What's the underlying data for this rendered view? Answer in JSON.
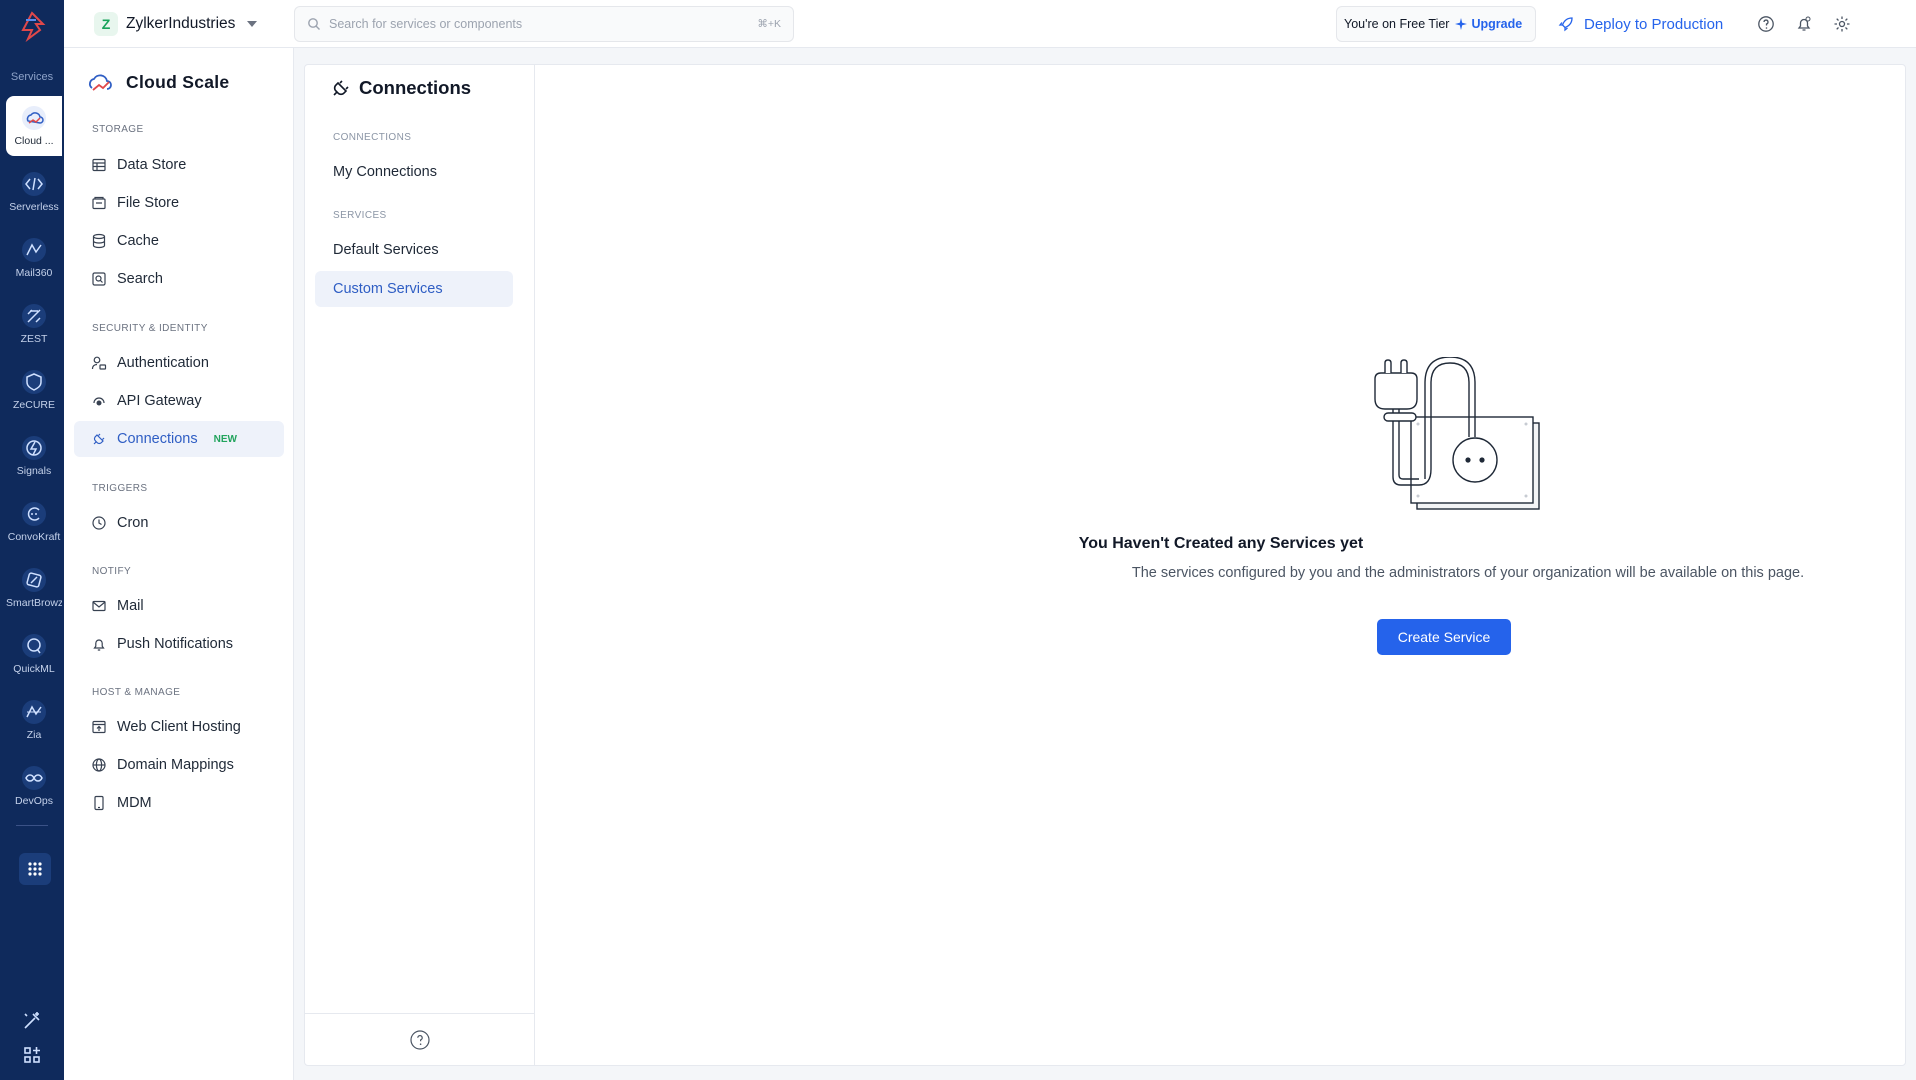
{
  "rail": {
    "services_label": "Services",
    "items": [
      {
        "label": "Cloud ...",
        "icon": "cloud-icon"
      },
      {
        "label": "Serverless",
        "icon": "serverless-icon"
      },
      {
        "label": "Mail360",
        "icon": "mail360-icon"
      },
      {
        "label": "ZEST",
        "icon": "zest-icon"
      },
      {
        "label": "ZeCURE",
        "icon": "zecure-icon"
      },
      {
        "label": "Signals",
        "icon": "signals-icon"
      },
      {
        "label": "ConvoKraft",
        "icon": "convokraft-icon"
      },
      {
        "label": "SmartBrowz",
        "icon": "smartbrowz-icon"
      },
      {
        "label": "QuickML",
        "icon": "quickml-icon"
      },
      {
        "label": "Zia",
        "icon": "zia-icon"
      },
      {
        "label": "DevOps",
        "icon": "devops-icon"
      }
    ]
  },
  "topbar": {
    "org_initial": "Z",
    "org_name": "ZylkerIndustries",
    "search_placeholder": "Search for services or components",
    "search_shortcut": "⌘+K",
    "tier_text": "You're on Free Tier",
    "upgrade_label": "Upgrade",
    "deploy_label": "Deploy to Production"
  },
  "sidebar": {
    "brand": "Cloud Scale",
    "sections": {
      "storage": "STORAGE",
      "security": "SECURITY & IDENTITY",
      "triggers": "TRIGGERS",
      "notify": "NOTIFY",
      "host": "HOST & MANAGE"
    },
    "items": {
      "data_store": "Data Store",
      "file_store": "File Store",
      "cache": "Cache",
      "search": "Search",
      "authentication": "Authentication",
      "api_gateway": "API Gateway",
      "connections": "Connections",
      "connections_badge": "NEW",
      "cron": "Cron",
      "mail": "Mail",
      "push": "Push Notifications",
      "web_hosting": "Web Client Hosting",
      "domain_mappings": "Domain Mappings",
      "mdm": "MDM"
    }
  },
  "subnav": {
    "title": "Connections",
    "cap_connections": "CONNECTIONS",
    "my_connections": "My Connections",
    "cap_services": "SERVICES",
    "default_services": "Default Services",
    "custom_services": "Custom Services"
  },
  "empty_state": {
    "title": "You Haven't Created any Services yet",
    "description": "The services configured by you and the administrators of your organization will be available on this page.",
    "button": "Create Service"
  },
  "colors": {
    "rail": "#0f2a5c",
    "accent": "#2563eb",
    "active_bg": "#eef2fa",
    "new_badge": "#22a45d"
  }
}
